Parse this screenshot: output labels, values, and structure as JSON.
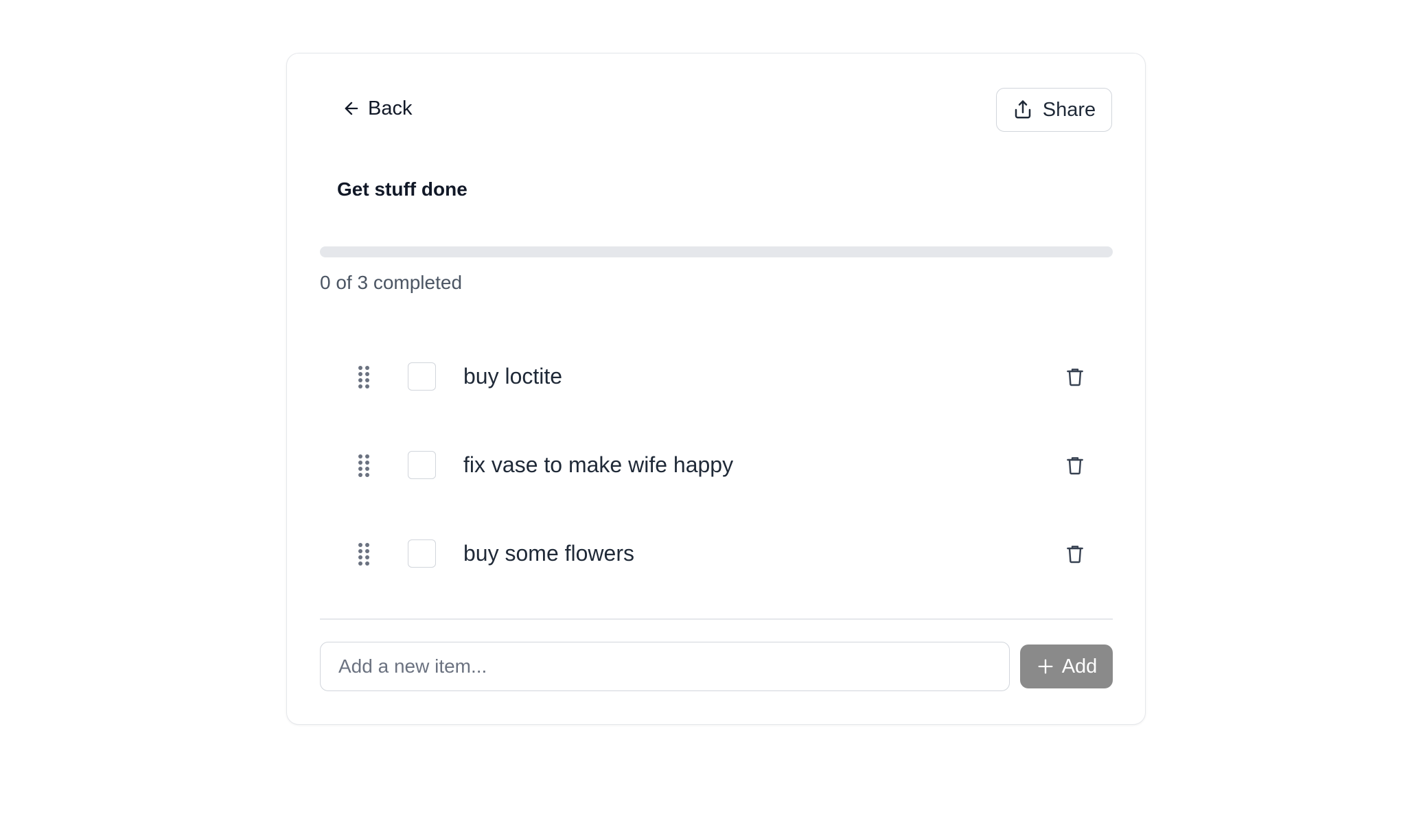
{
  "header": {
    "back_label": "Back",
    "share_label": "Share"
  },
  "list": {
    "title": "Get stuff done",
    "progress_text": "0 of 3 completed",
    "progress_fraction": 0,
    "completed_count": 0,
    "total_count": 3
  },
  "items": [
    {
      "label": "buy loctite",
      "checked": false
    },
    {
      "label": "fix vase to make wife happy",
      "checked": false
    },
    {
      "label": "buy some flowers",
      "checked": false
    }
  ],
  "composer": {
    "placeholder": "Add a new item...",
    "value": "",
    "add_label": "Add"
  },
  "icons": {
    "back": "arrow-left-icon",
    "share": "share-icon",
    "drag": "drag-handle-icon",
    "delete": "trash-icon",
    "add": "plus-icon"
  },
  "colors": {
    "progress_track": "#e5e7eb",
    "add_button_bg": "#8a8a8a",
    "text_primary": "#111827",
    "text_secondary": "#4b5563"
  }
}
